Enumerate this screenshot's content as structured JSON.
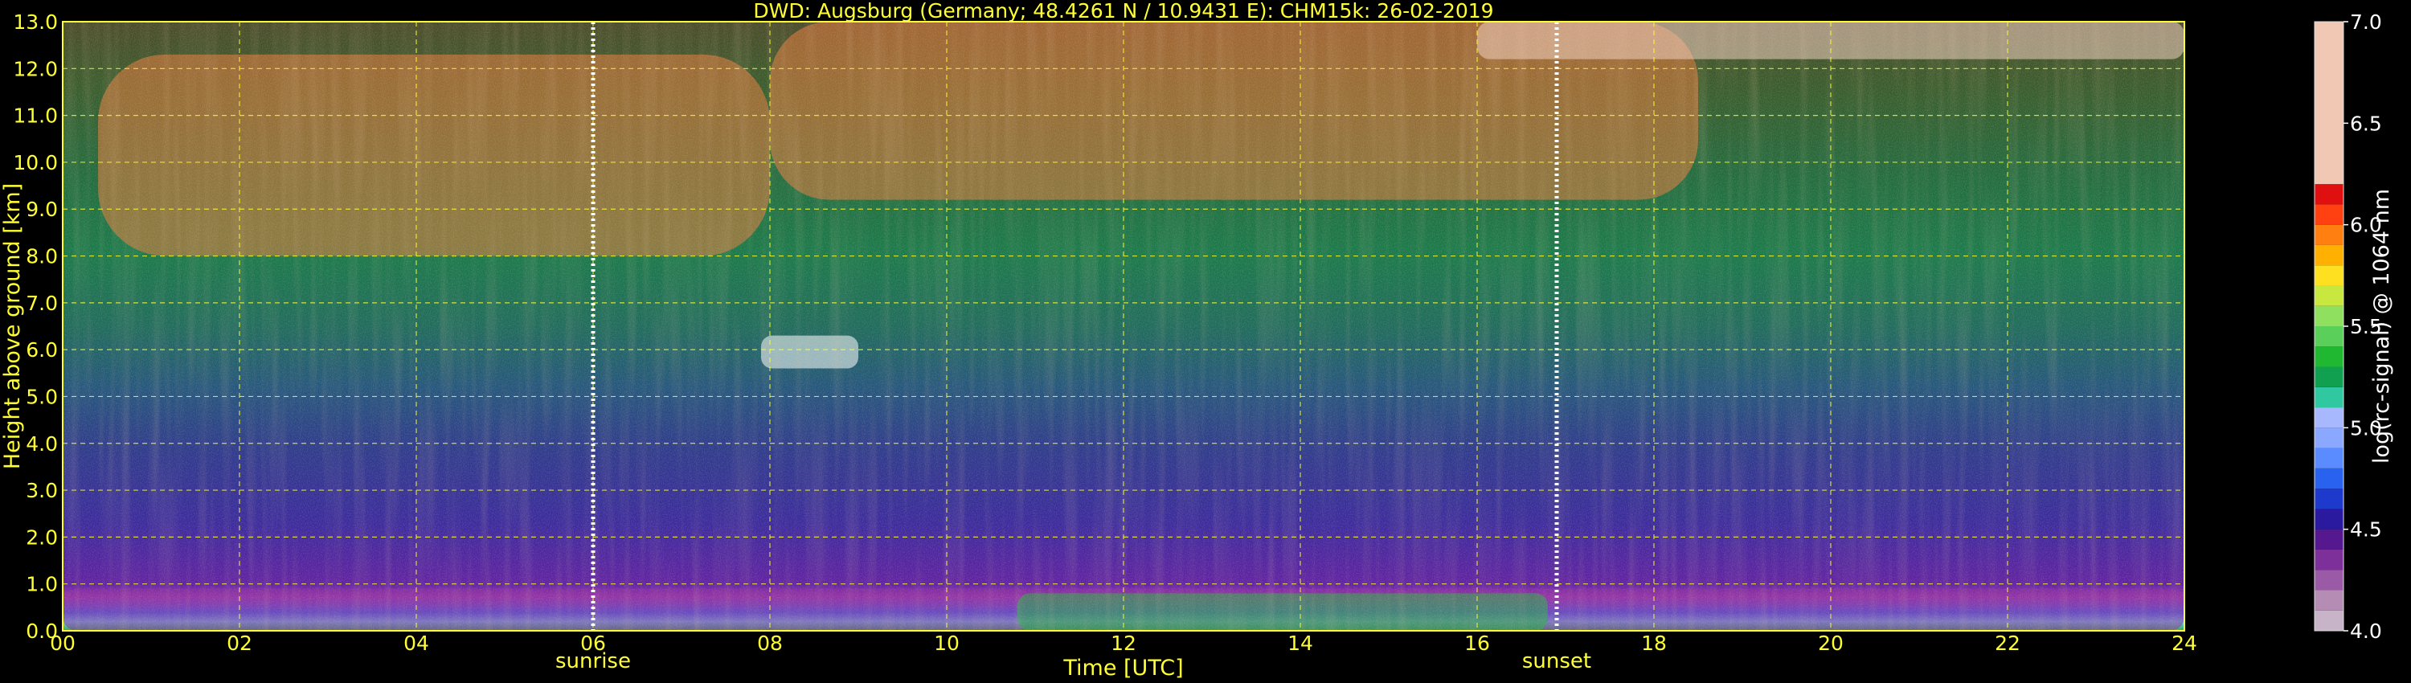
{
  "chart_data": {
    "type": "heatmap",
    "title": "DWD: Augsburg (Germany; 48.4261 N / 10.9431 E):    CHM15k: 26-02-2019",
    "xlabel": "Time [UTC]",
    "ylabel": "Height above ground [km]",
    "xlim": [
      0,
      24
    ],
    "ylim": [
      0,
      13
    ],
    "x_ticks": [
      "00",
      "02",
      "04",
      "06",
      "08",
      "10",
      "12",
      "14",
      "16",
      "18",
      "20",
      "22",
      "24"
    ],
    "y_ticks": [
      "0.0",
      "1.0",
      "2.0",
      "3.0",
      "4.0",
      "5.0",
      "6.0",
      "7.0",
      "8.0",
      "9.0",
      "10.0",
      "11.0",
      "12.0",
      "13.0"
    ],
    "grid": true,
    "markers": [
      {
        "label": "sunrise",
        "x": 6.0
      },
      {
        "label": "sunset",
        "x": 16.9
      }
    ],
    "colorbar": {
      "label": "log(rc-signal) @ 1064 nm",
      "range": [
        4.0,
        7.0
      ],
      "ticks": [
        "4.0",
        "4.5",
        "5.0",
        "5.5",
        "6.0",
        "6.5",
        "7.0"
      ],
      "levels": [
        4.0,
        4.1,
        4.2,
        4.3,
        4.4,
        4.5,
        4.6,
        4.7,
        4.8,
        4.9,
        5.0,
        5.1,
        5.2,
        5.3,
        5.4,
        5.5,
        5.6,
        5.7,
        5.8,
        5.9,
        6.0,
        6.1,
        6.2,
        7.0
      ],
      "colors": [
        "#c8b4c8",
        "#b48cb4",
        "#9a5aa6",
        "#7d2f9a",
        "#55188e",
        "#2a1aa0",
        "#1d3acc",
        "#2a62f0",
        "#5a8cff",
        "#8aa8ff",
        "#a8b8ff",
        "#30c8a0",
        "#10a050",
        "#20b830",
        "#5ad05a",
        "#90e060",
        "#c8e840",
        "#ffe020",
        "#ffb000",
        "#ff8010",
        "#ff4010",
        "#e01010",
        "#f0c8b4",
        "#e8e0dc",
        "#ffffff"
      ]
    },
    "features": [
      {
        "name": "boundary layer",
        "x_range": [
          0,
          24
        ],
        "z_range": [
          0.0,
          0.9
        ]
      },
      {
        "name": "mixing layer",
        "x_range": [
          10.8,
          16.8
        ],
        "z_range": [
          0.0,
          0.8
        ]
      },
      {
        "name": "upper cirrus",
        "x_range": [
          0.4,
          8.0
        ],
        "z_range": [
          8.0,
          12.3
        ]
      },
      {
        "name": "upper cirrus",
        "x_range": [
          8.0,
          18.5
        ],
        "z_range": [
          9.2,
          13.0
        ]
      },
      {
        "name": "mid cloud",
        "x_range": [
          7.9,
          9.0
        ],
        "z_range": [
          5.6,
          6.3
        ]
      },
      {
        "name": "upper cloud",
        "x_range": [
          16.0,
          24.0
        ],
        "z_range": [
          12.2,
          13.0
        ]
      }
    ]
  }
}
